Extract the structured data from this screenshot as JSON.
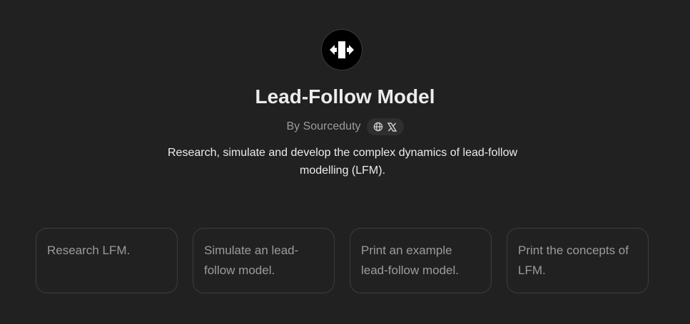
{
  "gpt": {
    "logo_icon": "left-right-arrows-block-icon",
    "title": "Lead-Follow Model",
    "byline_prefix": "By Sourceduty",
    "social_icons": [
      "globe-icon",
      "x-logo-icon"
    ],
    "description": "Research, simulate and develop the complex dynamics of lead-follow modelling (LFM)."
  },
  "conversation_starters": [
    {
      "label": "Research LFM."
    },
    {
      "label": "Simulate an lead-follow model."
    },
    {
      "label": "Print an example lead-follow model."
    },
    {
      "label": "Print the concepts of LFM."
    }
  ],
  "colors": {
    "background": "#212121",
    "text_primary": "#ececec",
    "text_secondary": "#9b9b9b",
    "card_border": "#3d3d3d"
  }
}
